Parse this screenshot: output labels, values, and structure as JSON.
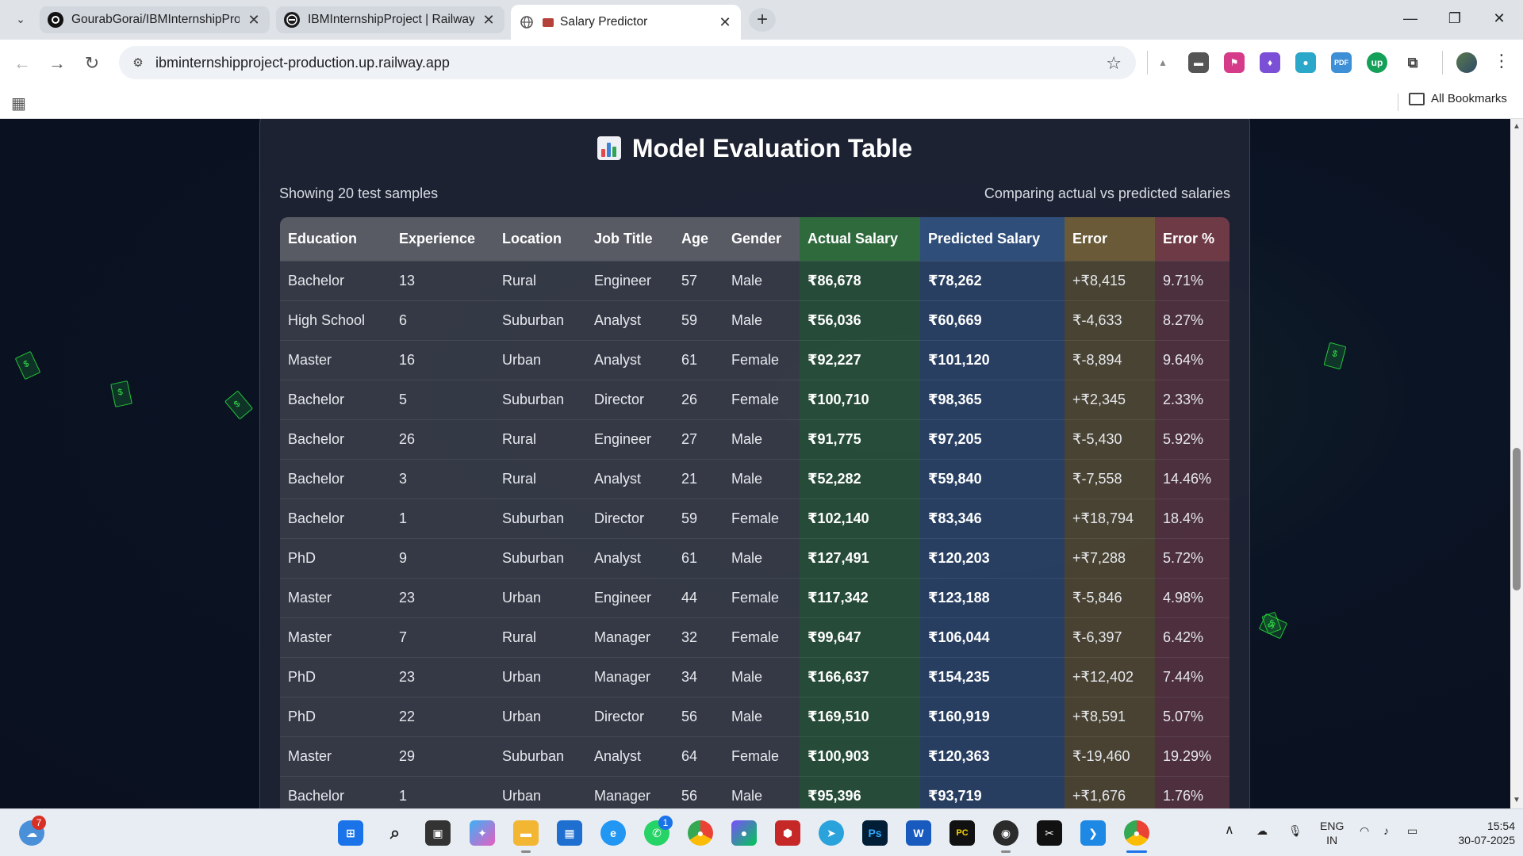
{
  "browser": {
    "tabs": [
      {
        "title": "GourabGorai/IBMInternshipProj",
        "active": false
      },
      {
        "title": "IBMInternshipProject | Railway",
        "active": false
      },
      {
        "title": "Salary Predictor",
        "active": true
      }
    ],
    "url": "ibminternshipproject-production.up.railway.app",
    "bookmarks_label": "All Bookmarks"
  },
  "page": {
    "title": "Model Evaluation Table",
    "showing": "Showing 20 test samples",
    "comparing": "Comparing actual vs predicted salaries",
    "columns": [
      "Education",
      "Experience",
      "Location",
      "Job Title",
      "Age",
      "Gender",
      "Actual Salary",
      "Predicted Salary",
      "Error",
      "Error %"
    ],
    "rows": [
      [
        "Bachelor",
        "13",
        "Rural",
        "Engineer",
        "57",
        "Male",
        "₹86,678",
        "₹78,262",
        "+₹8,415",
        "9.71%"
      ],
      [
        "High School",
        "6",
        "Suburban",
        "Analyst",
        "59",
        "Male",
        "₹56,036",
        "₹60,669",
        "₹-4,633",
        "8.27%"
      ],
      [
        "Master",
        "16",
        "Urban",
        "Analyst",
        "61",
        "Female",
        "₹92,227",
        "₹101,120",
        "₹-8,894",
        "9.64%"
      ],
      [
        "Bachelor",
        "5",
        "Suburban",
        "Director",
        "26",
        "Female",
        "₹100,710",
        "₹98,365",
        "+₹2,345",
        "2.33%"
      ],
      [
        "Bachelor",
        "26",
        "Rural",
        "Engineer",
        "27",
        "Male",
        "₹91,775",
        "₹97,205",
        "₹-5,430",
        "5.92%"
      ],
      [
        "Bachelor",
        "3",
        "Rural",
        "Analyst",
        "21",
        "Male",
        "₹52,282",
        "₹59,840",
        "₹-7,558",
        "14.46%"
      ],
      [
        "Bachelor",
        "1",
        "Suburban",
        "Director",
        "59",
        "Female",
        "₹102,140",
        "₹83,346",
        "+₹18,794",
        "18.4%"
      ],
      [
        "PhD",
        "9",
        "Suburban",
        "Analyst",
        "61",
        "Male",
        "₹127,491",
        "₹120,203",
        "+₹7,288",
        "5.72%"
      ],
      [
        "Master",
        "23",
        "Urban",
        "Engineer",
        "44",
        "Female",
        "₹117,342",
        "₹123,188",
        "₹-5,846",
        "4.98%"
      ],
      [
        "Master",
        "7",
        "Rural",
        "Manager",
        "32",
        "Female",
        "₹99,647",
        "₹106,044",
        "₹-6,397",
        "6.42%"
      ],
      [
        "PhD",
        "23",
        "Urban",
        "Manager",
        "34",
        "Male",
        "₹166,637",
        "₹154,235",
        "+₹12,402",
        "7.44%"
      ],
      [
        "PhD",
        "22",
        "Urban",
        "Director",
        "56",
        "Male",
        "₹169,510",
        "₹160,919",
        "+₹8,591",
        "5.07%"
      ],
      [
        "Master",
        "29",
        "Suburban",
        "Analyst",
        "64",
        "Female",
        "₹100,903",
        "₹120,363",
        "₹-19,460",
        "19.29%"
      ],
      [
        "Bachelor",
        "1",
        "Urban",
        "Manager",
        "56",
        "Male",
        "₹95,396",
        "₹93,719",
        "+₹1,676",
        "1.76%"
      ]
    ]
  },
  "taskbar": {
    "notification_badge": "7",
    "whatsapp_badge": "1",
    "language_line1": "ENG",
    "language_line2": "IN",
    "time": "15:54",
    "date": "30-07-2025"
  },
  "colors": {
    "page_bg": "#0a1020",
    "card_bg": "#1e2434",
    "actual_col": "#2f6a3d",
    "predicted_col": "#2f4f7a",
    "error_col": "#6a5a38",
    "error_pct_col": "#6e3a46",
    "note_green": "#23c63a"
  }
}
